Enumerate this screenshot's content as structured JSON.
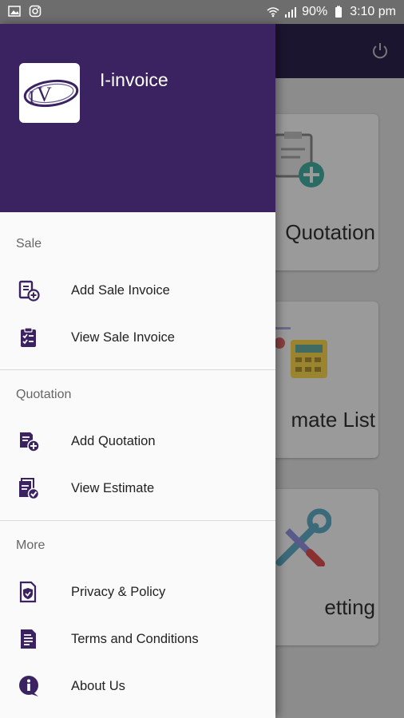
{
  "status_bar": {
    "battery": "90%",
    "time": "3:10 pm"
  },
  "background": {
    "cards": [
      "Quotation",
      "mate List",
      "etting"
    ]
  },
  "drawer": {
    "app_title": "I-invoice",
    "sections": [
      {
        "title": "Sale",
        "items": [
          {
            "label": "Add Sale Invoice",
            "icon": "add-invoice-icon"
          },
          {
            "label": "View Sale Invoice",
            "icon": "clipboard-checklist-icon"
          }
        ]
      },
      {
        "title": "Quotation",
        "items": [
          {
            "label": "Add Quotation",
            "icon": "add-document-icon"
          },
          {
            "label": "View Estimate",
            "icon": "document-check-icon"
          }
        ]
      },
      {
        "title": "More",
        "items": [
          {
            "label": "Privacy & Policy",
            "icon": "shield-document-icon"
          },
          {
            "label": "Terms and Conditions",
            "icon": "document-lines-icon"
          },
          {
            "label": "About Us",
            "icon": "info-icon"
          }
        ]
      }
    ]
  },
  "colors": {
    "header": "#3a2360",
    "icon": "#3a2360"
  }
}
